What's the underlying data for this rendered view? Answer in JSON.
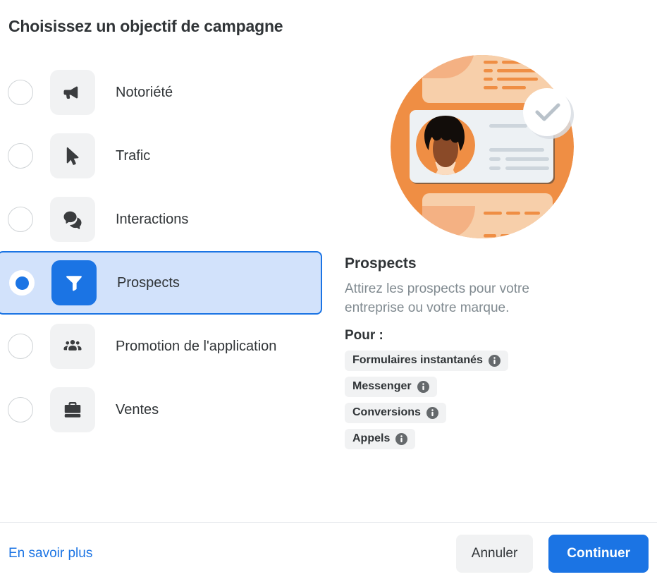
{
  "header": {
    "title": "Choisissez un objectif de campagne"
  },
  "objectives": [
    {
      "label": "Notoriété",
      "icon": "megaphone-icon",
      "selected": false
    },
    {
      "label": "Trafic",
      "icon": "cursor-icon",
      "selected": false
    },
    {
      "label": "Interactions",
      "icon": "chat-bubbles-icon",
      "selected": false
    },
    {
      "label": "Prospects",
      "icon": "funnel-icon",
      "selected": true
    },
    {
      "label": "Promotion de l'application",
      "icon": "people-group-icon",
      "selected": false
    },
    {
      "label": "Ventes",
      "icon": "briefcase-icon",
      "selected": false
    }
  ],
  "detail": {
    "illustration": "lead-form-illustration",
    "title": "Prospects",
    "description": "Attirez les prospects pour votre entreprise ou votre marque.",
    "for_label": "Pour :",
    "tags": [
      {
        "label": "Formulaires instantanés",
        "info": "info-icon"
      },
      {
        "label": "Messenger",
        "info": "info-icon"
      },
      {
        "label": "Conversions",
        "info": "info-icon"
      },
      {
        "label": "Appels",
        "info": "info-icon"
      }
    ]
  },
  "footer": {
    "learn_more": "En savoir plus",
    "cancel": "Annuler",
    "continue": "Continuer"
  },
  "colors": {
    "accent": "#1b74e4",
    "selected_row_bg": "#d2e2fb",
    "tile_bg": "#f1f2f3",
    "text": "#303437",
    "muted_text": "#808a90",
    "illustration_orange": "#ef8e44"
  }
}
